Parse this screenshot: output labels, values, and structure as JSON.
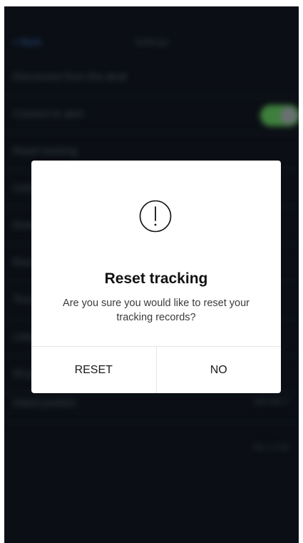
{
  "background": {
    "nav": {
      "back_label": "< Back",
      "title": "Settings"
    },
    "rows": [
      {
        "label": "Disconnect from this desk",
        "value": ""
      },
      {
        "label": "Connect to alert",
        "value": ""
      },
      {
        "label": "Reset tracking",
        "value": ""
      },
      {
        "label": "Units",
        "value": ""
      },
      {
        "label": "Desk height",
        "value": ""
      },
      {
        "label": "Reminders",
        "value": ""
      },
      {
        "label": "Touch lock",
        "value": ""
      },
      {
        "label": "Language",
        "value": ""
      },
      {
        "label": "Sit position",
        "value": ""
      },
      {
        "label": "Stand position",
        "value": "120 mm >"
      }
    ],
    "version": "Ver 1.0.00",
    "toggle_state": "on"
  },
  "dialog": {
    "icon": "alert-circle-icon",
    "title": "Reset tracking",
    "message": "Are you sure you would like to reset your tracking records?",
    "buttons": {
      "reset_label": "RESET",
      "no_label": "NO"
    }
  },
  "colors": {
    "overlay": "#0b0f15",
    "dialog_bg": "#ffffff",
    "toggle_on": "#3e7f3c"
  }
}
